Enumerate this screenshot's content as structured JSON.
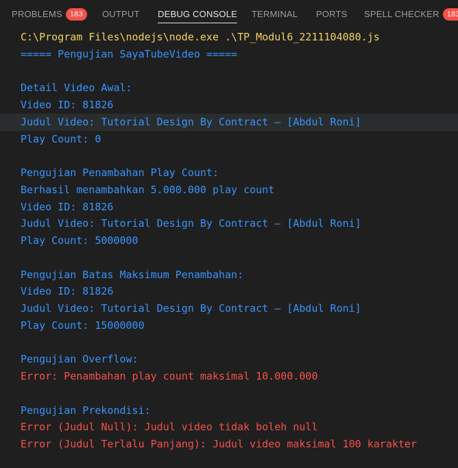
{
  "tabs": [
    {
      "label": "PROBLEMS",
      "badge": "183",
      "active": false
    },
    {
      "label": "OUTPUT",
      "active": false
    },
    {
      "label": "DEBUG CONSOLE",
      "active": true
    },
    {
      "label": "TERMINAL",
      "active": false
    },
    {
      "label": "PORTS",
      "active": false
    },
    {
      "label": "SPELL CHECKER",
      "badge": "183",
      "active": false
    }
  ],
  "console": {
    "lines": [
      {
        "text": "C:\\Program Files\\nodejs\\node.exe .\\TP_Modul6_2211104080.js",
        "kind": "command"
      },
      {
        "text": "===== Pengujian SayaTubeVideo =====",
        "kind": "info"
      },
      {
        "text": "",
        "kind": "blank"
      },
      {
        "text": "Detail Video Awal:",
        "kind": "info"
      },
      {
        "text": "Video ID: 81826",
        "kind": "info"
      },
      {
        "text": "Judul Video: Tutorial Design By Contract – [Abdul Roni]",
        "kind": "info",
        "highlight": true
      },
      {
        "text": "Play Count: 0",
        "kind": "info"
      },
      {
        "text": "",
        "kind": "blank"
      },
      {
        "text": "Pengujian Penambahan Play Count:",
        "kind": "info"
      },
      {
        "text": "Berhasil menambahkan 5.000.000 play count",
        "kind": "info"
      },
      {
        "text": "Video ID: 81826",
        "kind": "info"
      },
      {
        "text": "Judul Video: Tutorial Design By Contract – [Abdul Roni]",
        "kind": "info"
      },
      {
        "text": "Play Count: 5000000",
        "kind": "info"
      },
      {
        "text": "",
        "kind": "blank"
      },
      {
        "text": "Pengujian Batas Maksimum Penambahan:",
        "kind": "info"
      },
      {
        "text": "Video ID: 81826",
        "kind": "info"
      },
      {
        "text": "Judul Video: Tutorial Design By Contract – [Abdul Roni]",
        "kind": "info"
      },
      {
        "text": "Play Count: 15000000",
        "kind": "info"
      },
      {
        "text": "",
        "kind": "blank"
      },
      {
        "text": "Pengujian Overflow:",
        "kind": "info"
      },
      {
        "text": "Error: Penambahan play count maksimal 10.000.000",
        "kind": "error"
      },
      {
        "text": "",
        "kind": "blank"
      },
      {
        "text": "Pengujian Prekondisi:",
        "kind": "info"
      },
      {
        "text": "Error (Judul Null): Judul video tidak boleh null",
        "kind": "error"
      },
      {
        "text": "Error (Judul Terlalu Panjang): Judul video maksimal 100 karakter",
        "kind": "error"
      }
    ]
  },
  "colors": {
    "background": "#1f1f1f",
    "command": "#f2d35e",
    "info": "#3794ff",
    "error": "#f85149",
    "badge": "#f85149",
    "highlight": "#2a2d2e"
  }
}
